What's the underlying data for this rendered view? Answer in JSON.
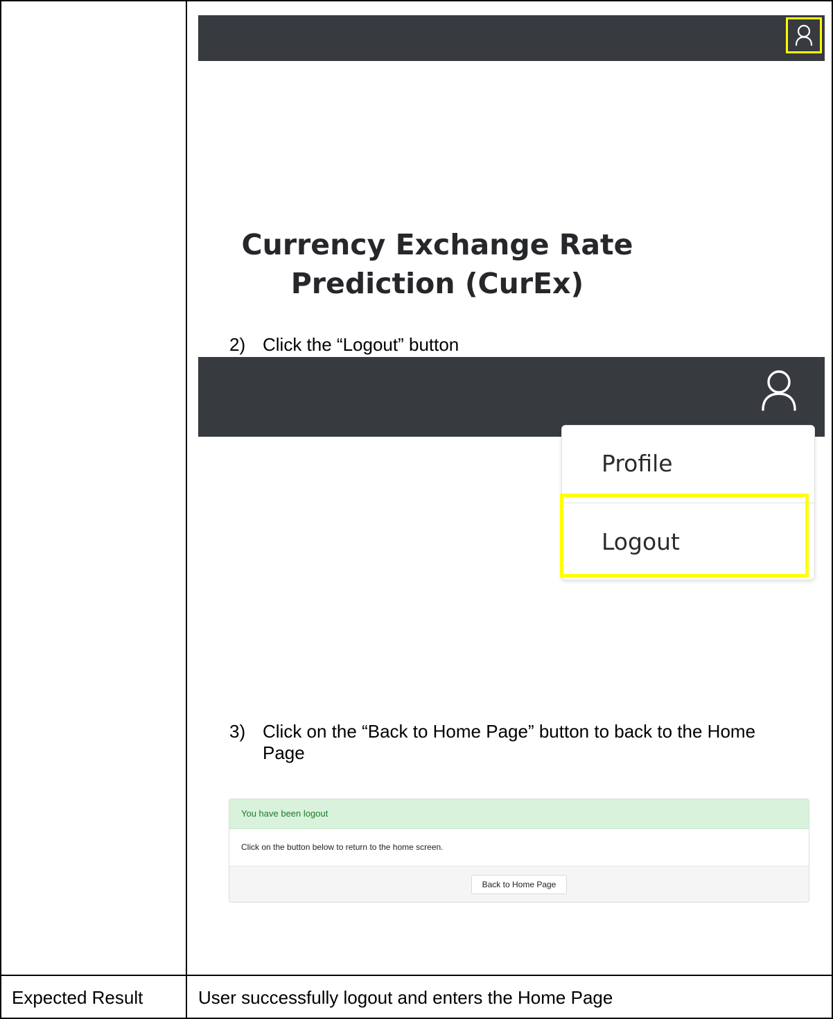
{
  "screenshot1": {
    "icon": "user-icon",
    "app_title_line1": "Currency Exchange Rate",
    "app_title_line2": "Prediction (CurEx)"
  },
  "step2": {
    "number": "2)",
    "text": "Click the “Logout” button"
  },
  "screenshot2": {
    "icon": "user-icon",
    "menu_items": [
      "Profile",
      "Logout"
    ]
  },
  "step3": {
    "number": "3)",
    "text_line1": "Click on the “Back to Home Page” button to back to the Home",
    "text_line2": "Page"
  },
  "screenshot3": {
    "alert_title": "You have been logout",
    "body_text": "Click on the button below to return to the home screen.",
    "button_label": "Back to Home Page"
  },
  "expected_result": {
    "label": "Expected Result",
    "value": "User successfully logout and enters the Home Page"
  },
  "colors": {
    "navbar": "#373a3f",
    "highlight": "#ffff00",
    "alert_bg": "#d9f2db",
    "alert_text": "#1d7a2c"
  }
}
